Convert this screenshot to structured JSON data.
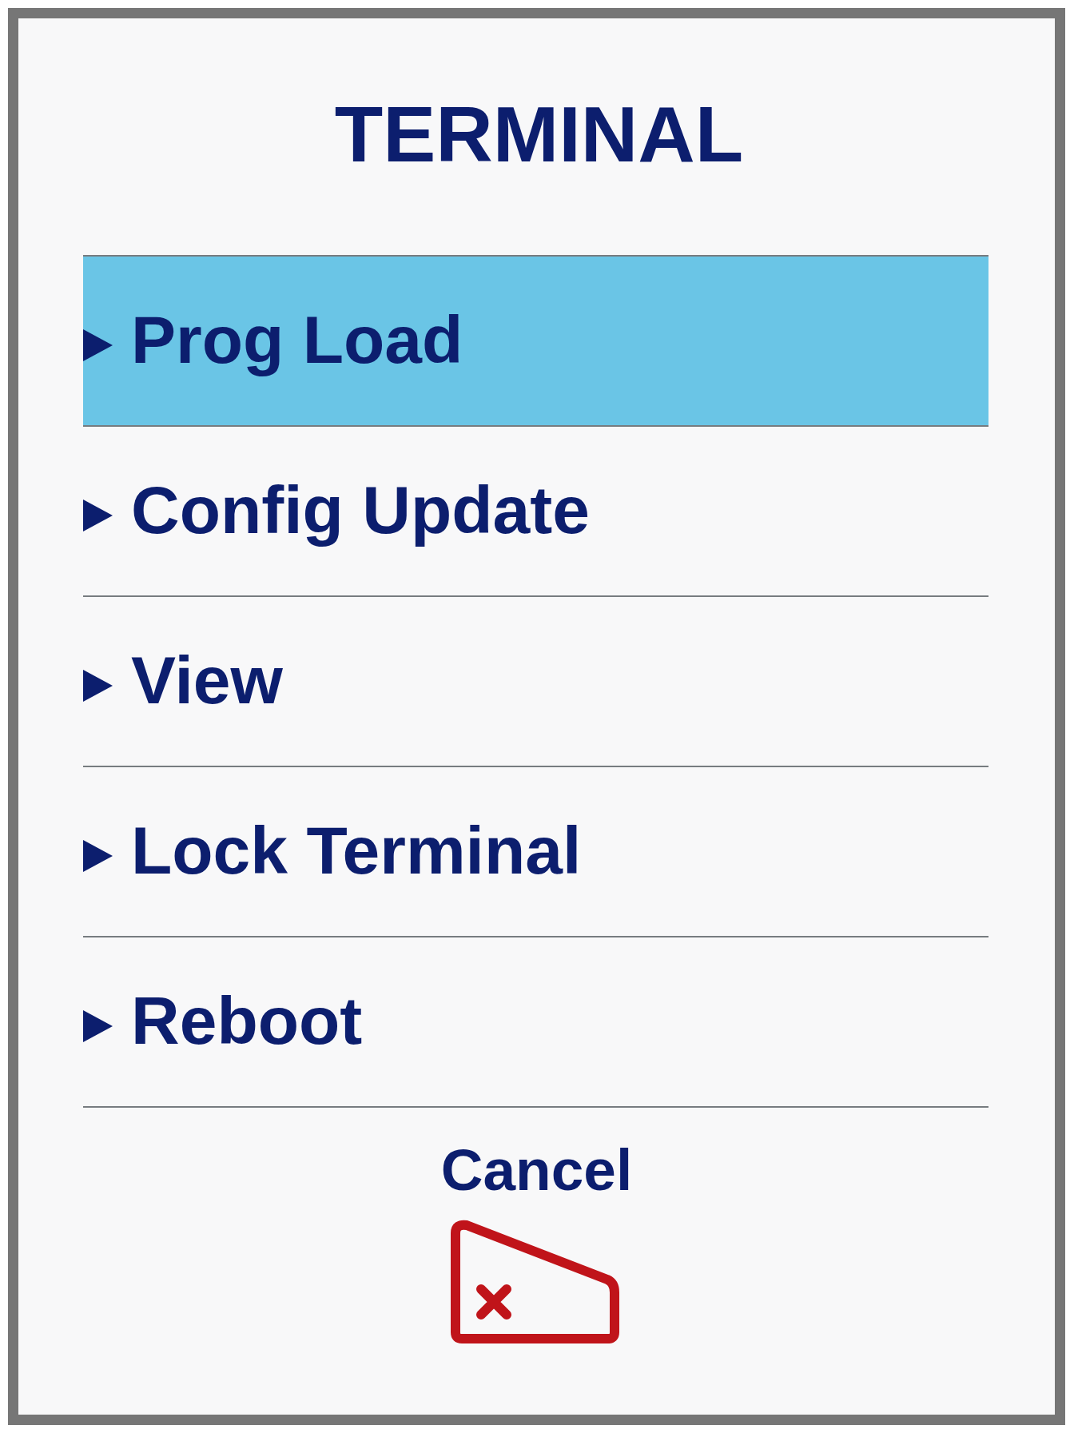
{
  "dialog": {
    "title": "TERMINAL"
  },
  "menu_items": [
    {
      "label": "Prog Load",
      "selected": true
    },
    {
      "label": "Config Update",
      "selected": false
    },
    {
      "label": "View",
      "selected": false
    },
    {
      "label": "Lock Terminal",
      "selected": false
    },
    {
      "label": "Reboot",
      "selected": false
    }
  ],
  "cancel_button": {
    "label": "Cancel"
  }
}
